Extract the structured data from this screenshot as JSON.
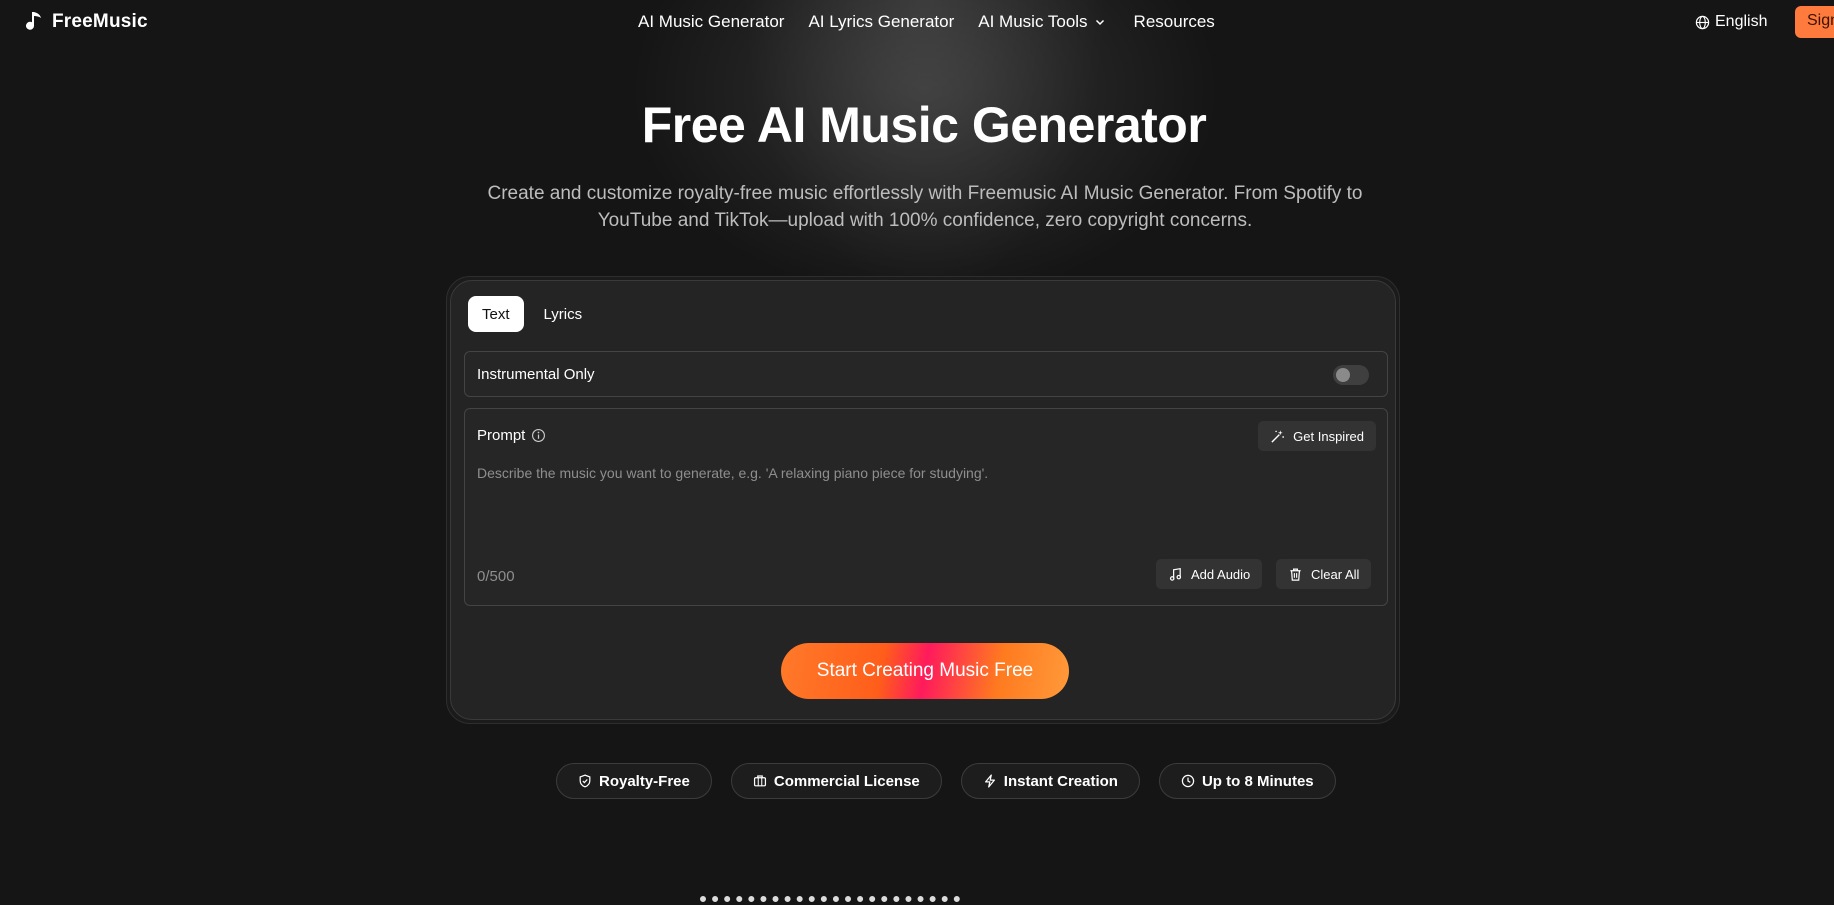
{
  "nav": {
    "logo_text": "FreeMusic",
    "links": [
      {
        "label": "AI Music Generator"
      },
      {
        "label": "AI Lyrics Generator"
      },
      {
        "label": "AI Music Tools"
      },
      {
        "label": "Resources"
      }
    ],
    "language": "English",
    "signin_label": "Sign"
  },
  "hero": {
    "title": "Free AI Music Generator",
    "subtitle": "Create and customize royalty-free music effortlessly with Freemusic AI Music Generator. From Spotify to YouTube and TikTok—upload with 100% confidence, zero copyright concerns."
  },
  "generator": {
    "tabs": [
      {
        "label": "Text",
        "active": true
      },
      {
        "label": "Lyrics",
        "active": false
      }
    ],
    "instrumental_label": "Instrumental Only",
    "instrumental_on": false,
    "prompt_label": "Prompt",
    "get_inspired_label": "Get Inspired",
    "prompt_placeholder": "Describe the music you want to generate, e.g. 'A relaxing piano piece for studying'.",
    "counter": "0/500",
    "add_audio_label": "Add Audio",
    "clear_all_label": "Clear All",
    "cta_label": "Start Creating Music Free"
  },
  "badges": [
    {
      "label": "Royalty-Free",
      "icon": "shield-icon"
    },
    {
      "label": "Commercial License",
      "icon": "briefcase-icon"
    },
    {
      "label": "Instant Creation",
      "icon": "lightning-icon"
    },
    {
      "label": "Up to 8 Minutes",
      "icon": "clock-icon"
    }
  ],
  "colors": {
    "background": "#151515",
    "accent": "#ff7a3d",
    "cta_gradient": [
      "#ff7a2a",
      "#ff1a5c",
      "#ff9a3a"
    ]
  }
}
